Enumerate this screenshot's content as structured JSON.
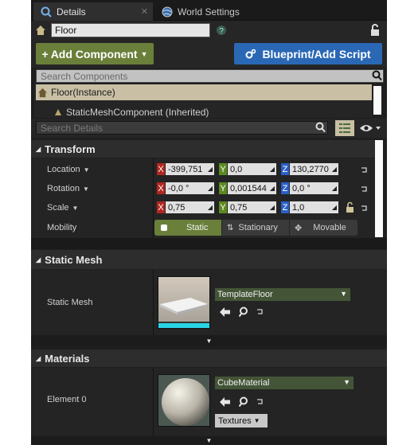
{
  "tabs": [
    {
      "label": "Details"
    },
    {
      "label": "World Settings"
    }
  ],
  "actor_name": "Floor",
  "buttons": {
    "add_component": "Add Component",
    "blueprint": "Blueprint/Add Script"
  },
  "search_components_placeholder": "Search Components",
  "component_tree": {
    "root": "Floor(Instance)",
    "child": "StaticMeshComponent (Inherited)"
  },
  "search_details_placeholder": "Search Details",
  "transform": {
    "title": "Transform",
    "rows": [
      {
        "label": "Location",
        "x": "-399,751",
        "y": "0,0",
        "z": "130,2770"
      },
      {
        "label": "Rotation",
        "x": "-0,0 °",
        "y": "0,001544",
        "z": "0,0 °"
      },
      {
        "label": "Scale",
        "x": "0,75",
        "y": "0,75",
        "z": "1,0"
      }
    ],
    "axes": [
      "X",
      "Y",
      "Z"
    ],
    "mobility_label": "Mobility",
    "mobility_options": [
      "Static",
      "Stationary",
      "Movable"
    ],
    "mobility_selected": "Static"
  },
  "static_mesh": {
    "title": "Static Mesh",
    "row_label": "Static Mesh",
    "asset": "TemplateFloor"
  },
  "materials": {
    "title": "Materials",
    "row_label": "Element 0",
    "asset": "CubeMaterial",
    "textures_label": "Textures"
  },
  "colors": {
    "panel_bg": "#1f1f1f",
    "add_component": "#6a7f3a",
    "blueprint": "#2a68b5",
    "axis_x": "#b3261e",
    "axis_y": "#5c8a1f",
    "axis_z": "#2a5fc8",
    "mobility_selected": "#6a7f3a",
    "selection": "#c8bfa4"
  },
  "icons": [
    "details-icon",
    "close-tab-icon",
    "globe-icon",
    "actor-icon",
    "help-icon",
    "lock-icon",
    "plus-icon",
    "chevron-down-icon",
    "blueprint-icon",
    "search-icon",
    "component-icon",
    "grid-view-icon",
    "eye-icon",
    "collapse-arrow-icon",
    "reset-arrow-icon",
    "browse-arrow-icon",
    "find-magnifier-icon",
    "padlock-icon"
  ]
}
